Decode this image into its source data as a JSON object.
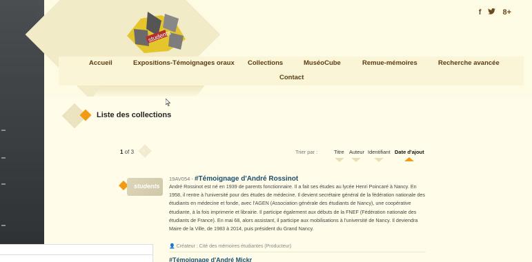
{
  "social": [
    "f",
    "t",
    "8+"
  ],
  "nav": {
    "items": [
      "Accueil",
      "Expositions-Témoignages oraux",
      "Collections",
      "MuséoCube",
      "Remue-mémoires",
      "Recherche avancée"
    ],
    "contact": "Contact"
  },
  "page_title": "Liste des collections",
  "pager": {
    "current": "1",
    "of_text": " of 3"
  },
  "sort": {
    "label": "Trier par :",
    "options": [
      "Titre",
      "Auteur",
      "Identifiant",
      "Date d'ajout"
    ]
  },
  "item": {
    "thumb_text": "students",
    "id": "19AV054 - ",
    "title": "#Témoignage d'André Rossinot",
    "description": "André Rossinot est né en 1939 de parents fonctionnaire. Il a fait ses études au lycée Henri Poincaré à Nancy. En 1958, il rentre à l'université pour des études de médecine. Il devient secrétaire général de la fédération nationale des étudiants en médecine et fonde, avec l'AGEN (Association générale des étudiants de Nancy), une coopérative étudiante, à la fois imprimerie et librairie. Il participe également aux débuts de la FNEF (Fédération nationale des étudiants de France). En mai 68, alors assistant, il participe aux mobilisations à l'université de Nancy. Il deviendra Maire de la Ville, de 1983 à 2014, puis président du Grand Nancy.",
    "creator": "Créateur : Cité des mémoires étudiantes (Producteur)"
  },
  "item2": {
    "title": "#Témoignage d'André Mickr"
  },
  "logo_text": "students",
  "colors": {
    "accent": "#f39a15",
    "nav_text": "#5a3b12",
    "link": "#1b4e6b"
  }
}
